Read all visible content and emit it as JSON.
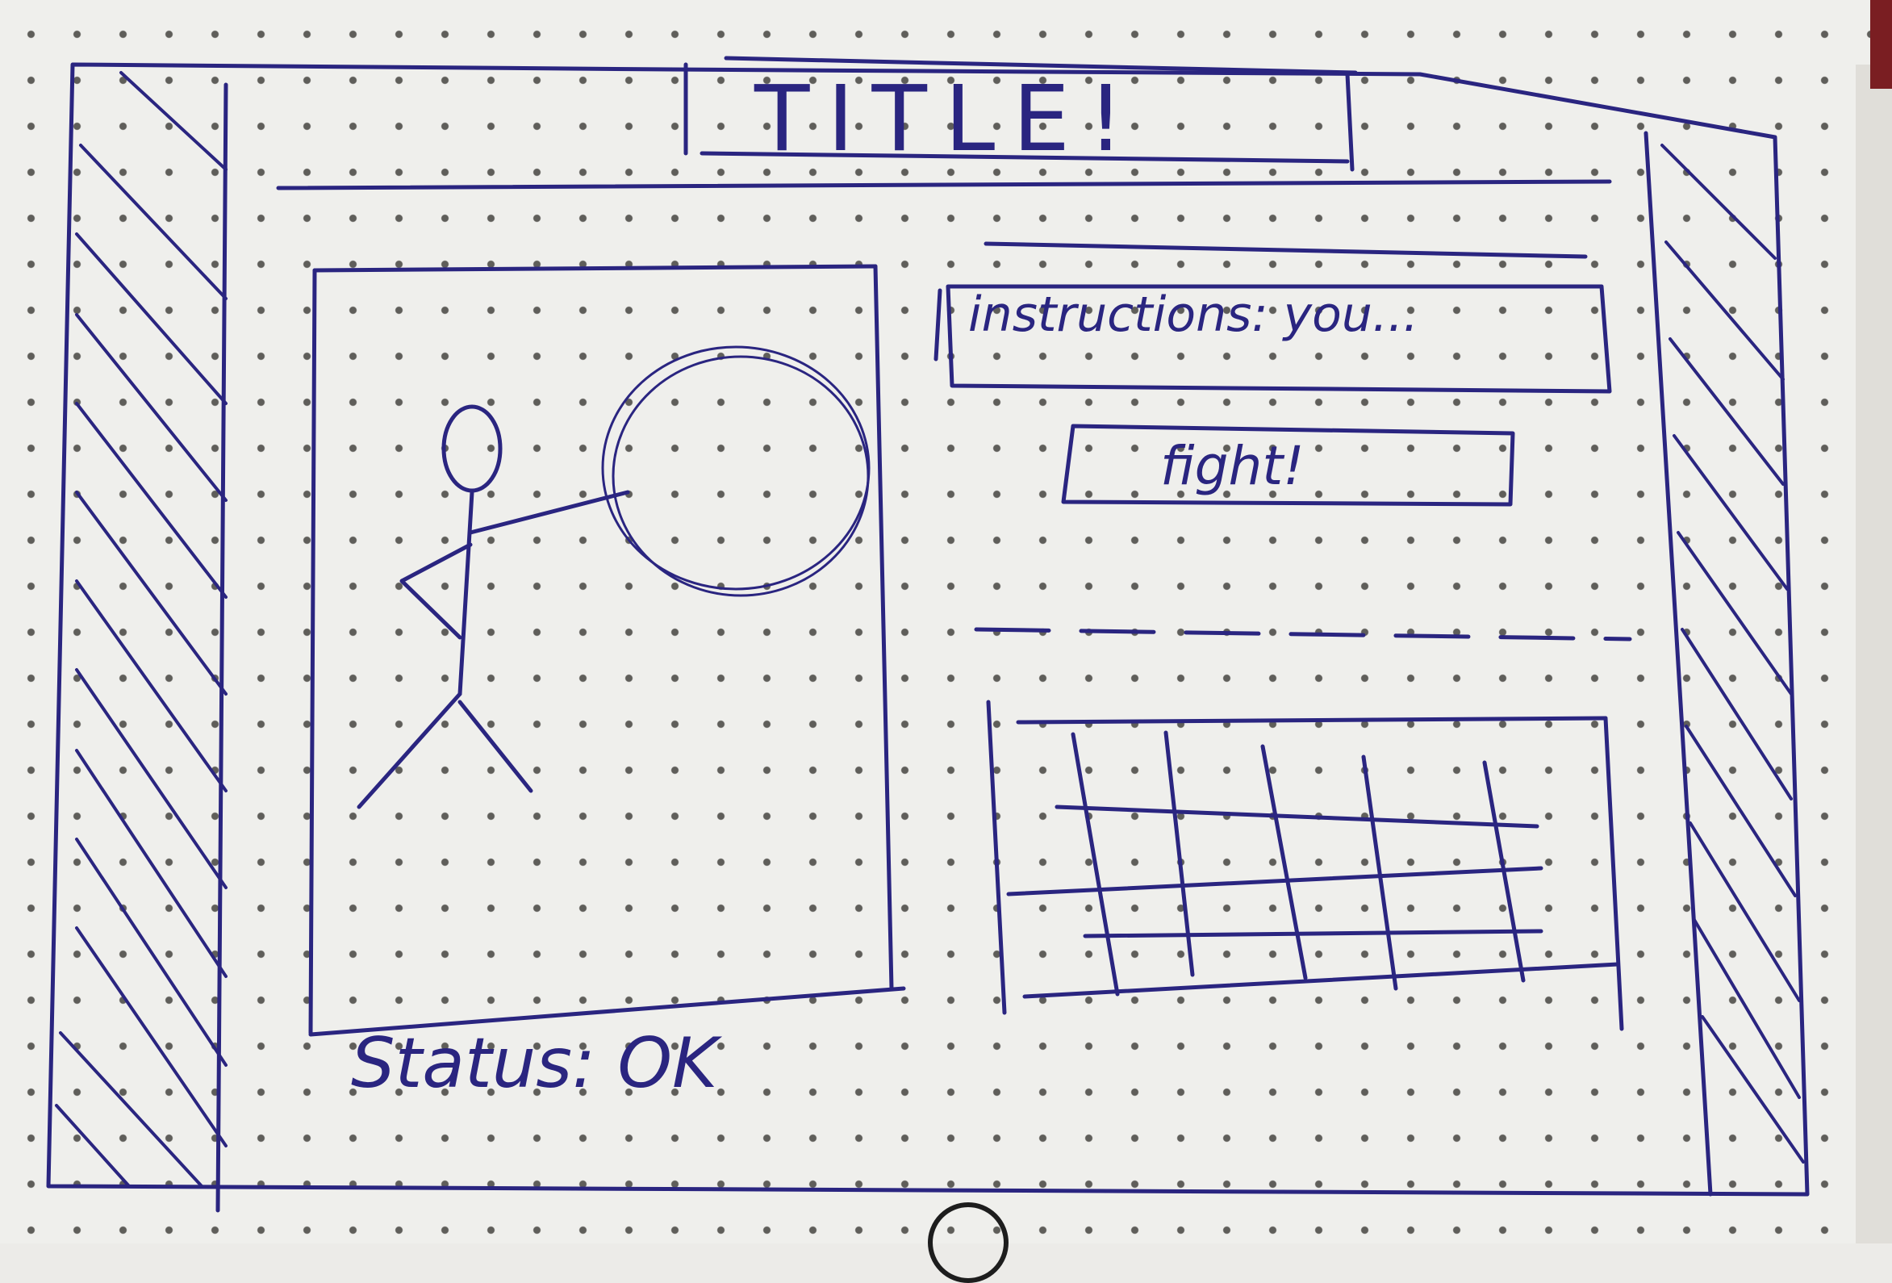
{
  "header": {
    "title": "TITLE!"
  },
  "instructions": {
    "text": "instructions: you..."
  },
  "fight_button": {
    "label": "fight!"
  },
  "status": {
    "text": "Status: OK"
  },
  "colors": {
    "ink": "#2a2580",
    "paper": "#efefec",
    "dots": "#5f5e5a"
  },
  "icons": [
    "stick-figure-icon",
    "circle-target-icon"
  ]
}
